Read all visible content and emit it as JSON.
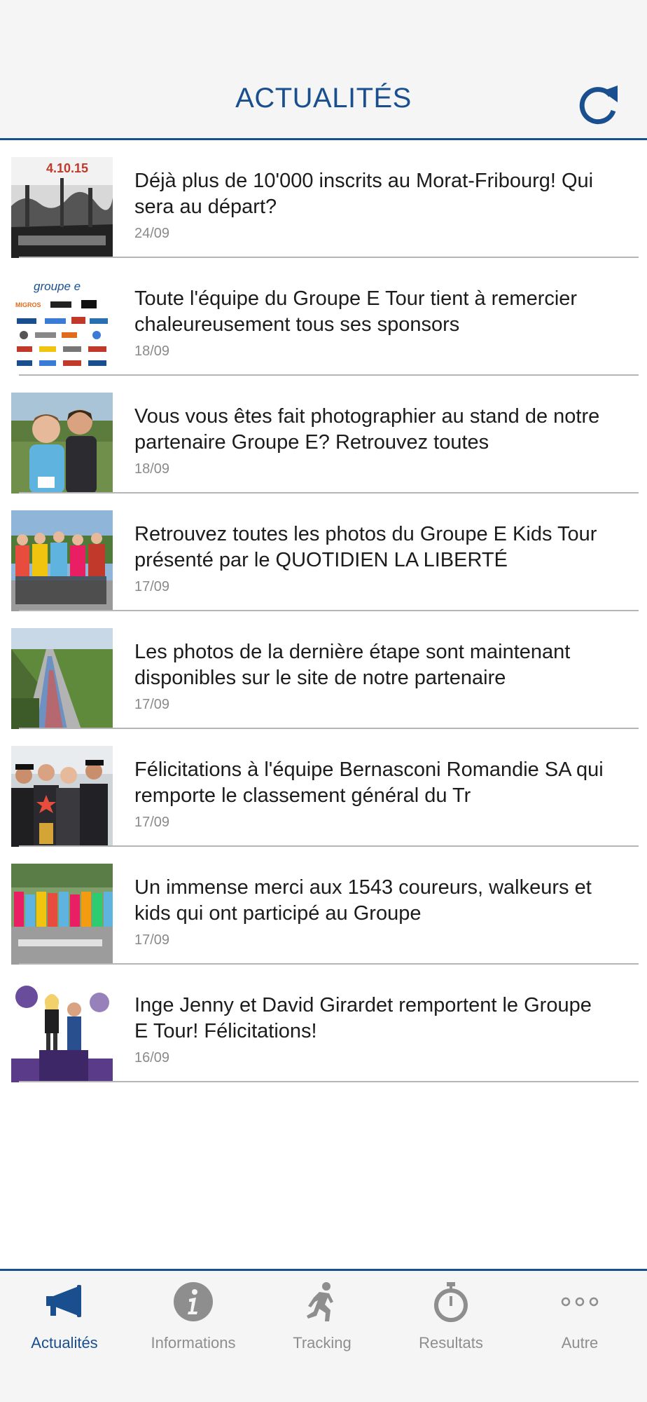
{
  "header": {
    "title": "ACTUALITÉS",
    "refresh_icon": "refresh-icon"
  },
  "news": [
    {
      "title": "Déjà plus de 10'000 inscrits au Morat-Fribourg! Qui sera au départ?",
      "date": "24/09"
    },
    {
      "title": "Toute l'équipe du Groupe E Tour tient à remercier chaleureusement tous ses sponsors",
      "date": "18/09"
    },
    {
      "title": "Vous vous êtes fait photographier au stand de notre partenaire Groupe E? Retrouvez toutes",
      "date": "18/09"
    },
    {
      "title": "Retrouvez toutes les photos du Groupe E Kids Tour présenté par le QUOTIDIEN LA LIBERTÉ",
      "date": "17/09"
    },
    {
      "title": "Les photos de la dernière étape sont maintenant disponibles sur le site de notre partenaire",
      "date": "17/09"
    },
    {
      "title": "Félicitations à l'équipe Bernasconi Romandie SA qui remporte le classement général du Tr",
      "date": "17/09"
    },
    {
      "title": "Un immense merci aux 1543 coureurs, walkeurs et kids qui ont participé au Groupe",
      "date": "17/09"
    },
    {
      "title": "Inge Jenny et David Girardet remportent le Groupe E Tour! Félicitations!",
      "date": "16/09"
    }
  ],
  "thumb_texts": {
    "t1": "4.10.15",
    "t2": "groupe e",
    "t2_sponsor": "MIGROS"
  },
  "tabs": [
    {
      "label": "Actualités",
      "icon": "megaphone-icon",
      "active": true
    },
    {
      "label": "Informations",
      "icon": "info-icon",
      "active": false
    },
    {
      "label": "Tracking",
      "icon": "runner-icon",
      "active": false
    },
    {
      "label": "Resultats",
      "icon": "stopwatch-icon",
      "active": false
    },
    {
      "label": "Autre",
      "icon": "more-icon",
      "active": false
    }
  ],
  "colors": {
    "accent": "#1a4f8f",
    "inactive": "#8e8e8e",
    "divider": "#b5b5b5"
  }
}
